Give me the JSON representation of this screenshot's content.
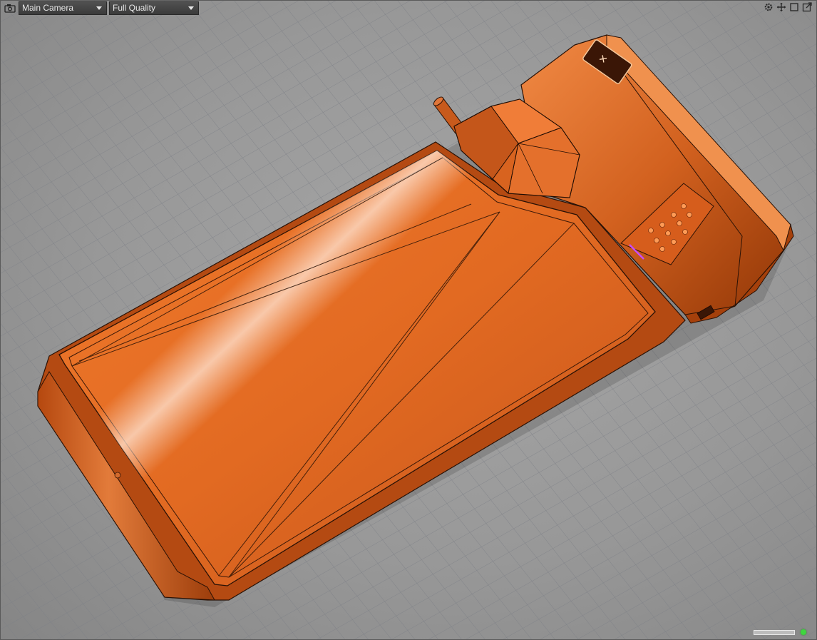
{
  "toolbar": {
    "camera_icon": "camera-icon",
    "camera_select": "Main Camera",
    "quality_select": "Full Quality"
  },
  "top_right_icons": [
    "gear-icon",
    "move-icon",
    "maximize-icon",
    "export-icon"
  ],
  "viewport": {
    "object": "flip-phone-model",
    "accent_color": "#e36a22",
    "background_color": "#9a9a9a",
    "grid": true
  },
  "status": {
    "progress": 1.0,
    "indicator_color": "#3fd63f"
  }
}
